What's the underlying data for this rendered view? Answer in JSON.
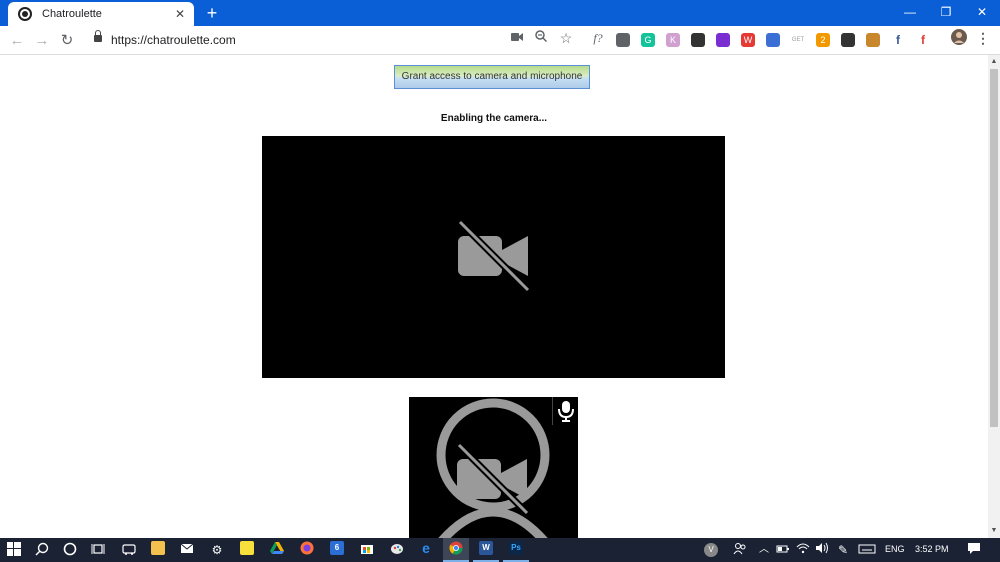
{
  "browser": {
    "tab_title": "Chatroulette",
    "tab_close": "✕",
    "new_tab": "+",
    "url": "https://chatroulette.com",
    "window_controls": {
      "minimize": "—",
      "restore": "❐",
      "close": "✕"
    },
    "nav": {
      "back": "←",
      "forward": "→",
      "reload": "↻"
    },
    "extensions": [
      {
        "name": "camera-ext-icon",
        "color": "#5f6368",
        "label": ""
      },
      {
        "name": "grammarly-icon",
        "color": "#15c39a",
        "label": "G"
      },
      {
        "name": "k-ext-icon",
        "color": "#d0a0d0",
        "label": "K"
      },
      {
        "name": "pip-icon",
        "color": "#333333",
        "label": ""
      },
      {
        "name": "download-ext-icon",
        "color": "#7a2ed1",
        "label": ""
      },
      {
        "name": "red-ext-icon",
        "color": "#e53935",
        "label": "W"
      },
      {
        "name": "shield-ext-icon",
        "color": "#3b6fd6",
        "label": ""
      },
      {
        "name": "getcrx-icon",
        "color": "#9e9e9e",
        "label": "GET"
      },
      {
        "name": "flag-ext-icon",
        "color": "#f29900",
        "label": "2"
      },
      {
        "name": "speaker-ext-icon",
        "color": "#333333",
        "label": ""
      },
      {
        "name": "cookie-ext-icon",
        "color": "#c8872d",
        "label": ""
      },
      {
        "name": "facebook-ext-icon",
        "color": "#3b5998",
        "label": "f"
      },
      {
        "name": "f-red-ext-icon",
        "color": "#e53935",
        "label": "f"
      }
    ],
    "formula_label": "f?"
  },
  "page": {
    "grant_button_label": "Grant access to camera and microphone",
    "status_text": "Enabling the camera..."
  },
  "taskbar": {
    "language": "ENG",
    "time": "3:52 PM",
    "user_initial": "V"
  },
  "colors": {
    "titlebar": "#0b5fd6",
    "video_bg": "#000000",
    "icon_gray": "#9a9a9a",
    "taskbar": "#1a2233"
  }
}
